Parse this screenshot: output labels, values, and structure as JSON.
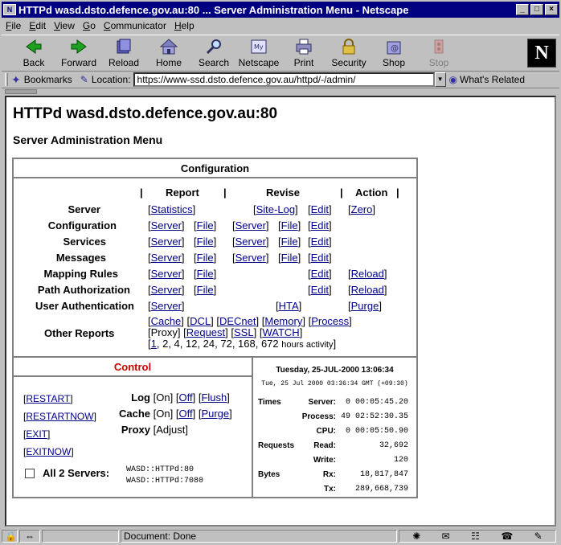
{
  "window": {
    "title": "HTTPd wasd.dsto.defence.gov.au:80 ... Server Administration Menu - Netscape"
  },
  "menu": [
    "File",
    "Edit",
    "View",
    "Go",
    "Communicator",
    "Help"
  ],
  "toolbar": {
    "back": "Back",
    "forward": "Forward",
    "reload": "Reload",
    "home": "Home",
    "search": "Search",
    "netscape": "Netscape",
    "print": "Print",
    "security": "Security",
    "shop": "Shop",
    "stop": "Stop"
  },
  "location": {
    "bookmarks": "Bookmarks",
    "label": "Location:",
    "url": "https://www-ssd.dsto.defence.gov.au/httpd/-/admin/",
    "related": "What's Related"
  },
  "page": {
    "title": "HTTPd wasd.dsto.defence.gov.au:80",
    "subtitle": "Server Administration Menu"
  },
  "config": {
    "heading": "Configuration",
    "col_report": "Report",
    "col_revise": "Revise",
    "col_action": "Action",
    "rows": {
      "server": {
        "label": "Server",
        "statistics": "Statistics",
        "sitelog": "Site-Log",
        "edit": "Edit",
        "zero": "Zero"
      },
      "configuration": {
        "label": "Configuration",
        "server": "Server",
        "file": "File",
        "rserver": "Server",
        "rfile": "File",
        "edit": "Edit"
      },
      "services": {
        "label": "Services",
        "server": "Server",
        "file": "File",
        "rserver": "Server",
        "rfile": "File",
        "edit": "Edit"
      },
      "messages": {
        "label": "Messages",
        "server": "Server",
        "file": "File",
        "rserver": "Server",
        "rfile": "File",
        "edit": "Edit"
      },
      "mapping": {
        "label": "Mapping Rules",
        "server": "Server",
        "file": "File",
        "edit": "Edit",
        "reload": "Reload"
      },
      "pathauth": {
        "label": "Path Authorization",
        "server": "Server",
        "file": "File",
        "edit": "Edit",
        "reload": "Reload"
      },
      "userauth": {
        "label": "User Authentication",
        "server": "Server",
        "hta": "HTA",
        "purge": "Purge"
      },
      "other": {
        "label": "Other Reports",
        "cache": "Cache",
        "dcl": "DCL",
        "decnet": "DECnet",
        "memory": "Memory",
        "process": "Process",
        "proxy": "[Proxy]",
        "request": "Request",
        "ssl": "SSL",
        "watch": "WATCH",
        "hours_first": "1",
        "hours_rest": ", 2, 4, 12, 24, 72, 168, 672",
        "hours_suffix": "hours activity",
        "hours_close": "]"
      }
    }
  },
  "control": {
    "heading": "Control",
    "restart": "RESTART",
    "restartnow": "RESTARTNOW",
    "exit": "EXIT",
    "exitnow": "EXITNOW",
    "log_label": "Log",
    "log_on": "[On]",
    "log_off": "Off",
    "log_flush": "Flush",
    "cache_label": "Cache",
    "cache_on": "[On]",
    "cache_off": "Off",
    "cache_purge": "Purge",
    "proxy_label": "Proxy",
    "proxy_adjust": "[Adjust]",
    "all_servers": "All 2 Servers:",
    "server1": "WASD::HTTPd:80",
    "server2": "WASD::HTTPd:7080"
  },
  "stats": {
    "date": "Tuesday, 25-JUL-2000 13:06:34",
    "gmt": "Tue, 25 Jul 2000 03:36:34 GMT (+09:30)",
    "times_label": "Times",
    "server_label": "Server:",
    "server_val": "0 00:05:45.20",
    "process_label": "Process:",
    "process_val": "49 02:52:30.35",
    "cpu_label": "CPU:",
    "cpu_val": "0 00:05:50.90",
    "requests_label": "Requests",
    "read_label": "Read:",
    "read_val": "32,692",
    "write_label": "Write:",
    "write_val": "120",
    "bytes_label": "Bytes",
    "rx_label": "Rx:",
    "rx_val": "18,817,847",
    "tx_label": "Tx:",
    "tx_val": "289,668,739"
  },
  "status": {
    "text": "Document: Done"
  },
  "colors": {
    "link": "#00008b",
    "control_heading": "#cc0000",
    "titlebar": "#000080"
  }
}
